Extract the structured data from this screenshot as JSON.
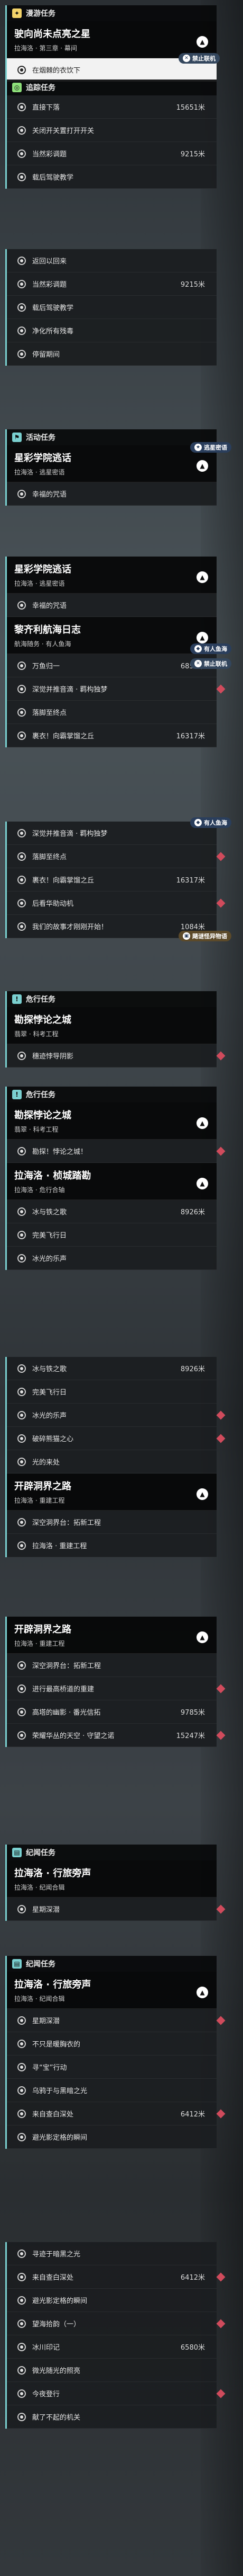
{
  "s1": {
    "title": "漫游任务",
    "card": {
      "title": "驶向尚未点亮之星",
      "sub": "拉海洛 · 第三章 · 幕间"
    },
    "highlight": "在烟棘的衣饮下",
    "tag": "禁止联机"
  },
  "s2": {
    "title": "追踪任务",
    "rows": [
      {
        "label": "直接下落",
        "dist": "15651米"
      },
      {
        "label": "关闭开关置打开开关",
        "dist": ""
      },
      {
        "label": "当然彩调题",
        "dist": "9215米"
      },
      {
        "label": "载后驾驶教学",
        "dist": ""
      }
    ]
  },
  "s2b": {
    "rows": [
      {
        "label": "返回以回来",
        "dist": ""
      },
      {
        "label": "当然彩调题",
        "dist": "9215米"
      },
      {
        "label": "载后驾驶教学",
        "dist": ""
      },
      {
        "label": "净化所有残毒",
        "dist": ""
      },
      {
        "label": "停留期间",
        "dist": ""
      }
    ]
  },
  "s3": {
    "title": "活动任务",
    "card": {
      "title": "星彩学院逃话",
      "sub": "拉海洛 · 逃星密语"
    },
    "tag": "逃星密语",
    "rows": [
      {
        "label": "幸福的咒语",
        "dist": ""
      }
    ]
  },
  "s3b": {
    "card": {
      "title": "星彩学院逃话",
      "sub": "拉海洛 · 逃星密语"
    },
    "rows": [
      {
        "label": "幸福的咒语",
        "dist": ""
      }
    ]
  },
  "s4": {
    "card": {
      "title": "黎齐利航海日志",
      "sub": "航海随务 · 有人鱼海"
    },
    "tag": "有人鱼海",
    "tag2": "禁止联机",
    "rows": [
      {
        "label": "万鱼归一",
        "dist": "6857米"
      },
      {
        "label": "深觉并推音滴 · 羁构独梦",
        "dist": ""
      },
      {
        "label": "落脚至终点",
        "dist": ""
      },
      {
        "label": "裹衣！向霸掌馏之丘",
        "dist": "16317米"
      }
    ]
  },
  "s4b": {
    "tag": "有人鱼海",
    "rows": [
      {
        "label": "深觉并推音滴 · 羁构独梦",
        "dist": ""
      },
      {
        "label": "落脚至终点",
        "dist": ""
      },
      {
        "label": "裹衣！向霸掌馏之丘",
        "dist": "16317米"
      },
      {
        "label": "后看华助动机",
        "dist": ""
      },
      {
        "label": "我们的故事才刚刚开始！",
        "dist": "1084米"
      }
    ],
    "tag2": "飓谜怪异物语"
  },
  "s5": {
    "title": "危行任务",
    "card": {
      "title": "勘探悖论之城",
      "sub": "翡翠 · 科考工程"
    },
    "rows": [
      {
        "label": "穗迹悖导阴影",
        "dist": ""
      }
    ]
  },
  "s6": {
    "title": "危行任务",
    "card": {
      "title": "勘探悖论之城",
      "sub": "翡翠 · 科考工程"
    },
    "rows": [
      {
        "label": "勘探！悖论之城！",
        "dist": ""
      }
    ],
    "card2": {
      "title": "拉海洛 · 桢城踏勘",
      "sub": "拉海洛 · 危行合轴"
    },
    "rows2": [
      {
        "label": "冰与铁之歌",
        "dist": "8926米"
      },
      {
        "label": "完美飞行日",
        "dist": ""
      },
      {
        "label": "冰光的乐声",
        "dist": ""
      }
    ]
  },
  "s6b": {
    "rows": [
      {
        "label": "冰与铁之歌",
        "dist": "8926米"
      },
      {
        "label": "完美飞行日",
        "dist": ""
      },
      {
        "label": "冰光的乐声",
        "dist": ""
      },
      {
        "label": "破碎熊猫之心",
        "dist": ""
      },
      {
        "label": "光的来处",
        "dist": ""
      }
    ],
    "card": {
      "title": "开辟洞界之路",
      "sub": "拉海洛 · 重建工程"
    },
    "rows2": [
      {
        "label": "深空洞界台：拓新工程",
        "dist": ""
      },
      {
        "label": "拉海洛 · 重建工程",
        "dist": ""
      }
    ]
  },
  "s7": {
    "card": {
      "title": "开辟洞界之路",
      "sub": "拉海洛 · 重建工程"
    },
    "rows": [
      {
        "label": "深空洞界台：拓新工程",
        "dist": ""
      },
      {
        "label": "进行最高桥道的重建",
        "dist": ""
      },
      {
        "label": "高塔的幽影 · 番光信拓",
        "dist": "9785米"
      },
      {
        "label": "荣耀华丛的天空 · 守望之诺",
        "dist": "15247米"
      }
    ]
  },
  "s8": {
    "title": "纪闻任务",
    "card": {
      "title": "拉海洛 · 行旅旁声",
      "sub": "拉海洛 · 纪闻合辑"
    },
    "rows": [
      {
        "label": "星期深潜",
        "dist": ""
      }
    ]
  },
  "s9": {
    "title": "纪闻任务",
    "card": {
      "title": "拉海洛 · 行旅旁声",
      "sub": "拉海洛 · 纪闻合辑"
    },
    "rows": [
      {
        "label": "星期深潜",
        "dist": ""
      },
      {
        "label": "不只是暖胸衣的",
        "dist": ""
      },
      {
        "label": "寻“宝”行动",
        "dist": ""
      },
      {
        "label": "乌鸦于与黑暗之光",
        "dist": ""
      },
      {
        "label": "来自查白深处",
        "dist": "6412米"
      },
      {
        "label": "避光影定格的瞬间",
        "dist": ""
      }
    ]
  },
  "s9b": {
    "rows": [
      {
        "label": "寻迹于暗黑之光",
        "dist": ""
      },
      {
        "label": "来自查白深处",
        "dist": "6412米"
      },
      {
        "label": "避光影定格的瞬间",
        "dist": ""
      },
      {
        "label": "望海拾韵（一）",
        "dist": ""
      },
      {
        "label": "冰川印记",
        "dist": "6580米"
      },
      {
        "label": "微光随光的照亮",
        "dist": ""
      },
      {
        "label": "今夜登行",
        "dist": ""
      },
      {
        "label": "献了不起的机关",
        "dist": ""
      }
    ]
  }
}
